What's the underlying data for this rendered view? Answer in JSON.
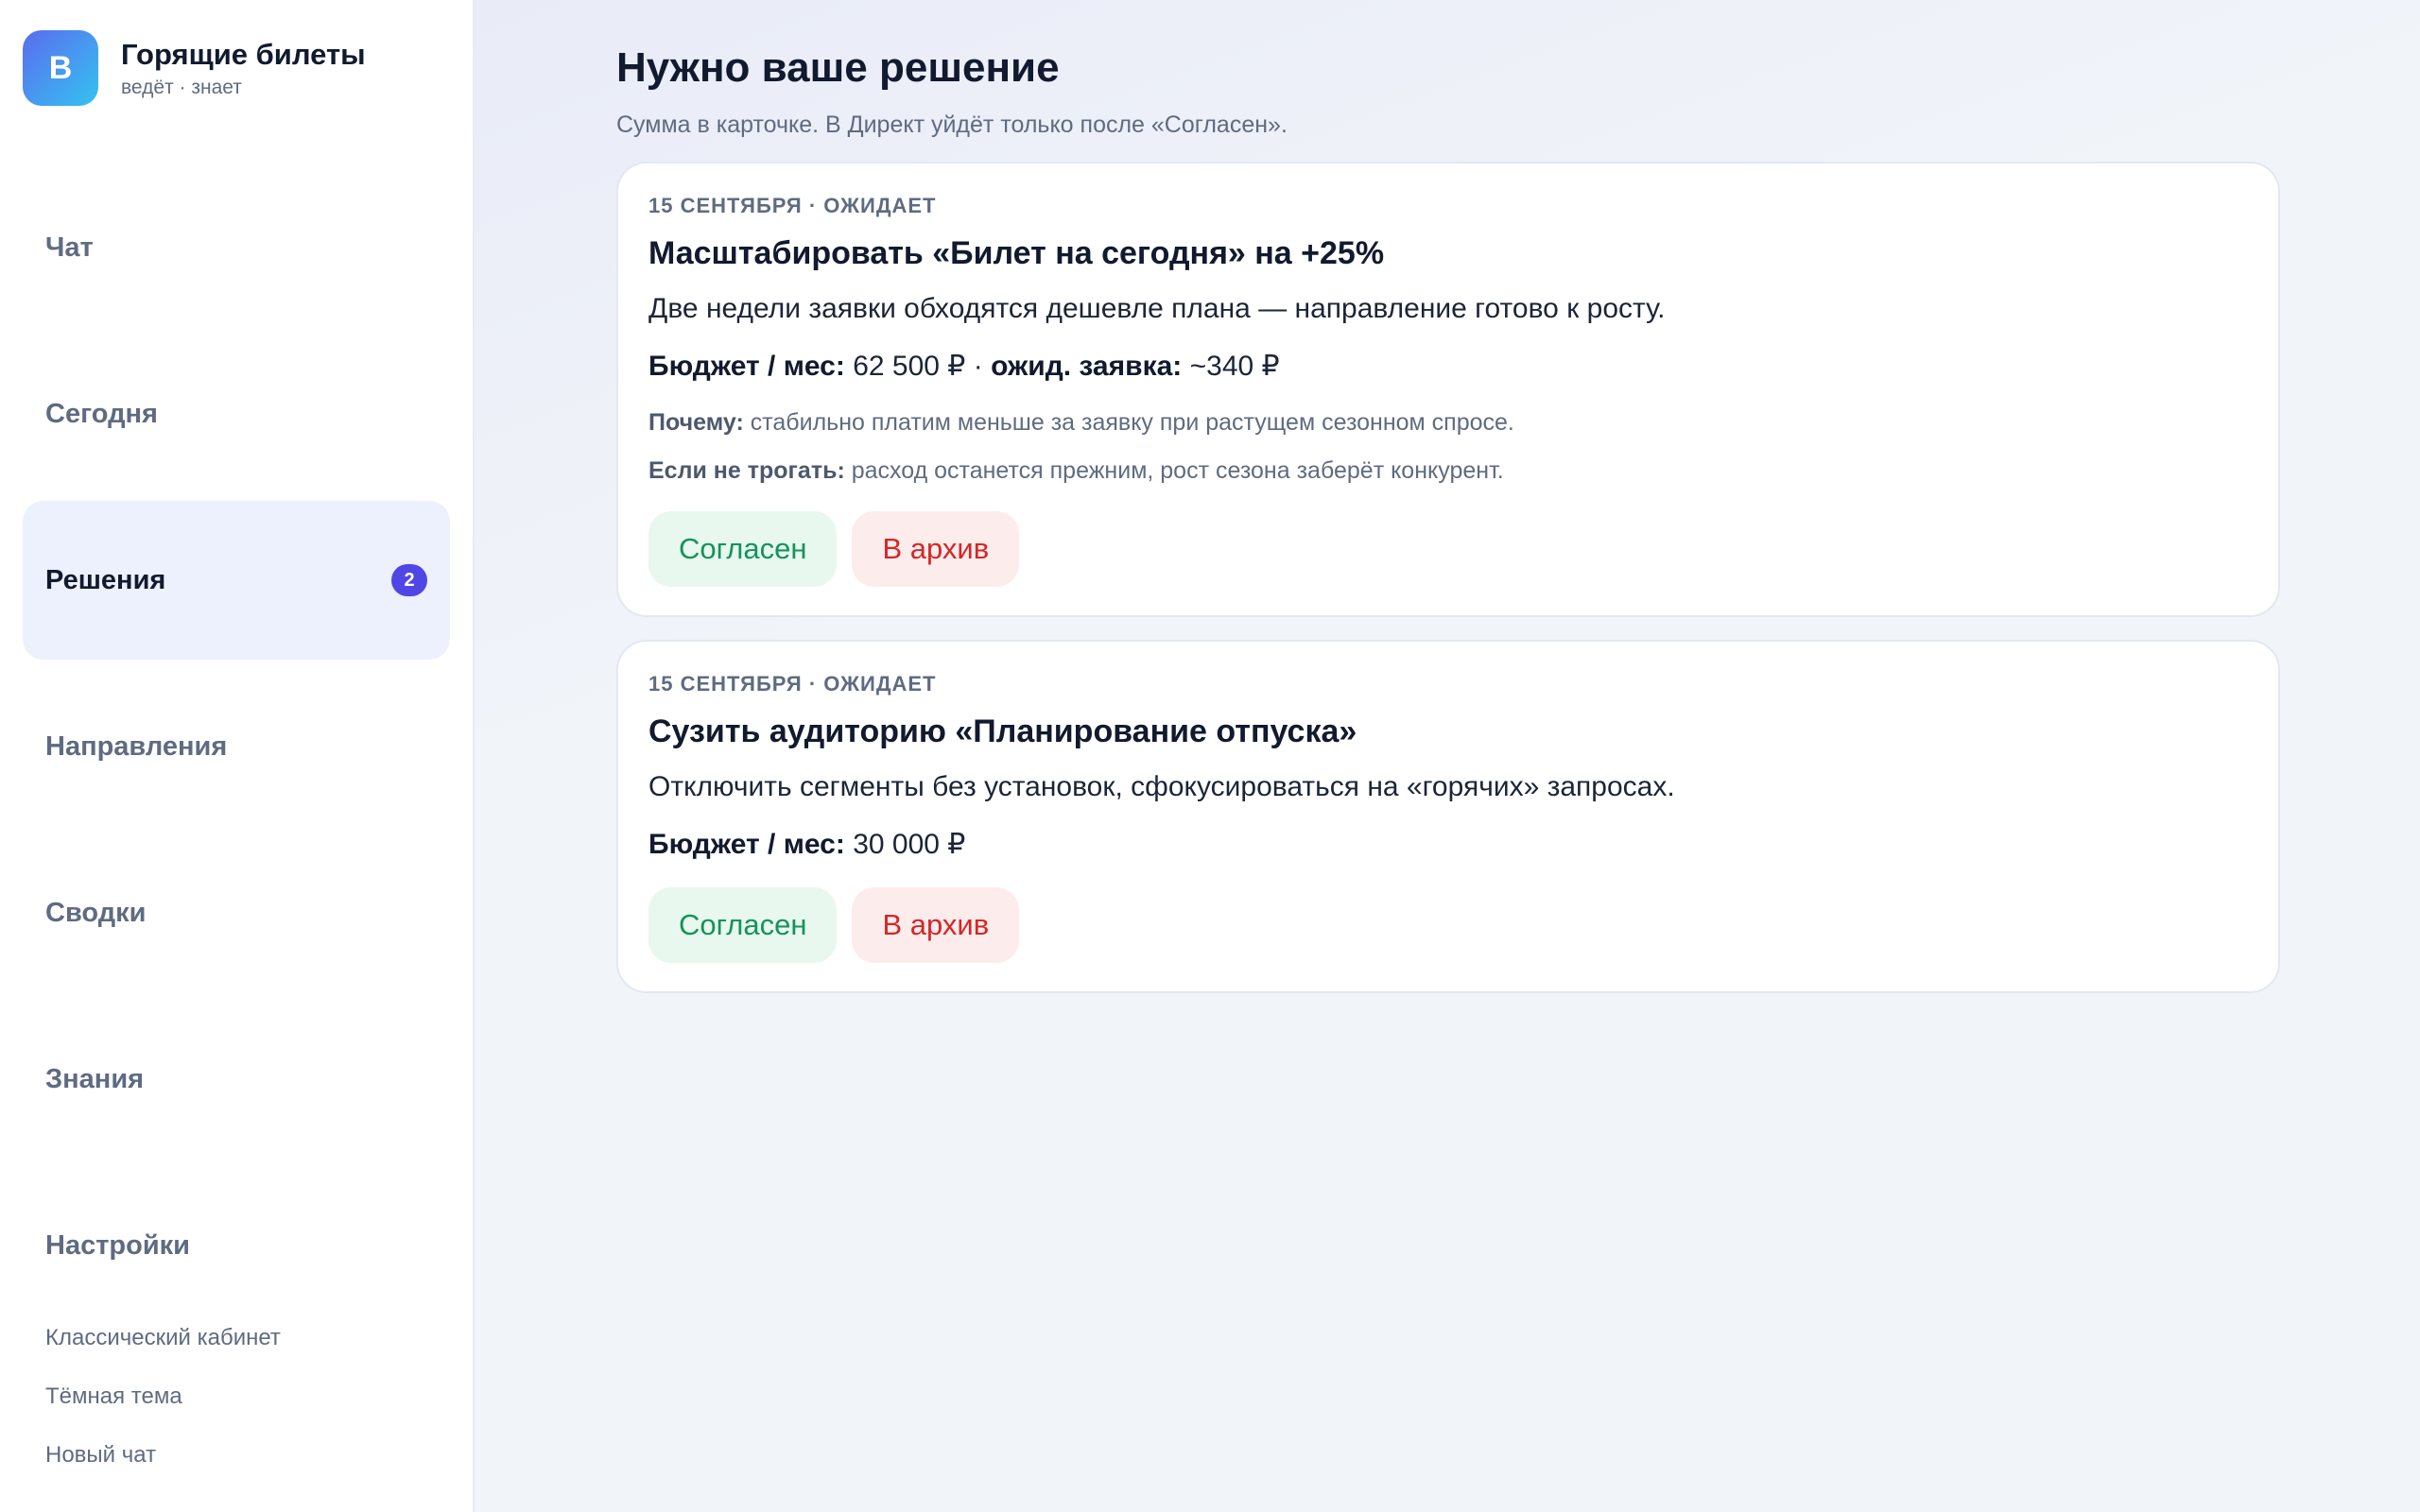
{
  "sidebar": {
    "brand": {
      "logo_letter": "В",
      "title": "Горящие билеты",
      "subtitle": "ведёт · знает"
    },
    "items": [
      {
        "label": "Чат",
        "active": false
      },
      {
        "label": "Сегодня",
        "active": false
      },
      {
        "label": "Решения",
        "active": true,
        "badge": "2"
      },
      {
        "label": "Направления",
        "active": false
      },
      {
        "label": "Сводки",
        "active": false
      },
      {
        "label": "Знания",
        "active": false
      },
      {
        "label": "Настройки",
        "active": false
      }
    ],
    "links": [
      "Классический кабинет",
      "Тёмная тема",
      "Новый чат"
    ]
  },
  "main": {
    "title": "Нужно ваше решение",
    "subtitle": "Сумма в карточке. В Директ уйдёт только после «Согласен».",
    "cards": [
      {
        "meta": "15 СЕНТЯБРЯ · ОЖИДАЕТ",
        "title": "Масштабировать «Билет на сегодня» на +25%",
        "description": "Две недели заявки обходятся дешевле плана — направление готово к росту.",
        "budget_label": "Бюджет / мес:",
        "budget_value": "62 500 ₽",
        "separator": " · ",
        "expected_label": "ожид. заявка:",
        "expected_value": "~340 ₽",
        "why_label": "Почему:",
        "why_text": "стабильно платим меньше за заявку при растущем сезонном спросе.",
        "if_not_label": "Если не трогать:",
        "if_not_text": "расход останется прежним, рост сезона заберёт конкурент.",
        "agree_label": "Согласен",
        "archive_label": "В архив"
      },
      {
        "meta": "15 СЕНТЯБРЯ · ОЖИДАЕТ",
        "title": "Сузить аудиторию «Планирование отпуска»",
        "description": "Отключить сегменты без установок, сфокусироваться на «горячих» запросах.",
        "budget_label": "Бюджет / мес:",
        "budget_value": "30 000 ₽",
        "agree_label": "Согласен",
        "archive_label": "В архив"
      }
    ]
  },
  "colors": {
    "accent": "#4f46e5",
    "agree_text": "#15935a",
    "agree_bg": "#e8f8ef",
    "archive_text": "#d32727",
    "archive_bg": "#fdecec",
    "nav_active_bg": "#edf0fd"
  }
}
